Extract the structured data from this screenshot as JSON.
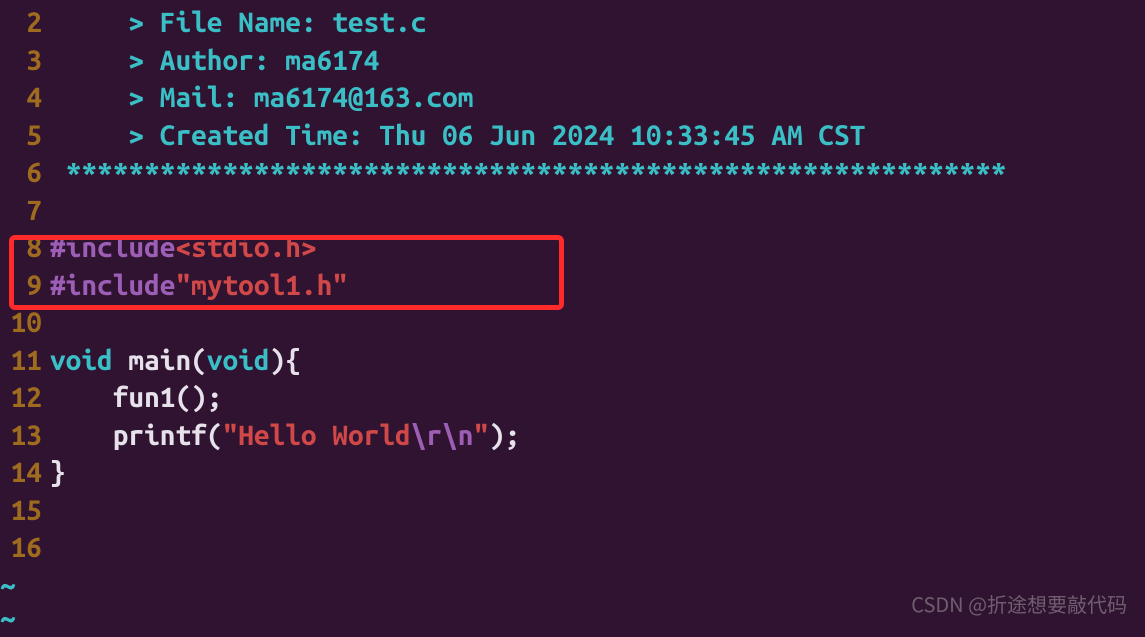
{
  "lines": [
    {
      "n": "2",
      "pre": "     ",
      "txt": "> File Name: test.c"
    },
    {
      "n": "3",
      "pre": "     ",
      "txt": "> Author: ma6174"
    },
    {
      "n": "4",
      "pre": "     ",
      "txt": "> Mail: ma6174@163.com "
    },
    {
      "n": "5",
      "pre": "     ",
      "txt": "> Created Time: Thu 06 Jun 2024 10:33:45 AM CST"
    },
    {
      "n": "6",
      "pre": " ",
      "txt": "************************************************************"
    },
    {
      "n": "7",
      "txt": ""
    },
    {
      "n": "8",
      "inc": true,
      "hdr": "<stdio.h>"
    },
    {
      "n": "9",
      "inc": true,
      "hdr": "\"mytool1.h\""
    },
    {
      "n": "10",
      "txt": ""
    },
    {
      "n": "11",
      "main": true
    },
    {
      "n": "12",
      "call": "fun1"
    },
    {
      "n": "13",
      "printf": true,
      "str": "\"Hello World",
      "esc": "\\r\\n",
      "endq": "\""
    },
    {
      "n": "14",
      "brace": "}"
    },
    {
      "n": "15",
      "txt": ""
    },
    {
      "n": "16",
      "txt": ""
    }
  ],
  "incKw": "#include",
  "voidKw": "void",
  "mainId": "main",
  "printfId": "printf",
  "tilde": "~",
  "watermark": "CSDN @折途想要敲代码"
}
